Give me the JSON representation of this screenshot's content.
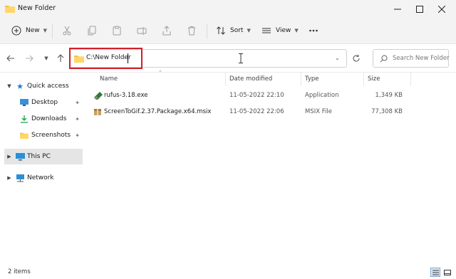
{
  "window": {
    "title": "New Folder"
  },
  "toolbar": {
    "new_label": "New",
    "sort_label": "Sort",
    "view_label": "View"
  },
  "address": {
    "path": "C:\\New Folder"
  },
  "search": {
    "placeholder": "Search New Folder"
  },
  "sidebar": {
    "quick_access": "Quick access",
    "items": [
      {
        "label": "Desktop",
        "icon": "desktop-icon"
      },
      {
        "label": "Downloads",
        "icon": "download-arrow-icon"
      },
      {
        "label": "Screenshots",
        "icon": "folder-icon"
      }
    ],
    "this_pc": "This PC",
    "network": "Network"
  },
  "columns": {
    "name": "Name",
    "date": "Date modified",
    "type": "Type",
    "size": "Size"
  },
  "files": [
    {
      "name": "rufus-3.18.exe",
      "date": "11-05-2022 22:10",
      "type": "Application",
      "size": "1,349 KB",
      "icon": "usb-drive-app-icon"
    },
    {
      "name": "ScreenToGif.2.37.Package.x64.msix",
      "date": "11-05-2022 22:06",
      "type": "MSIX File",
      "size": "77,308 KB",
      "icon": "package-box-icon"
    }
  ],
  "status": {
    "count": "2 items"
  },
  "colors": {
    "highlight": "#d21f2b",
    "folder": "#f3c33b",
    "accent": "#0063b1"
  }
}
